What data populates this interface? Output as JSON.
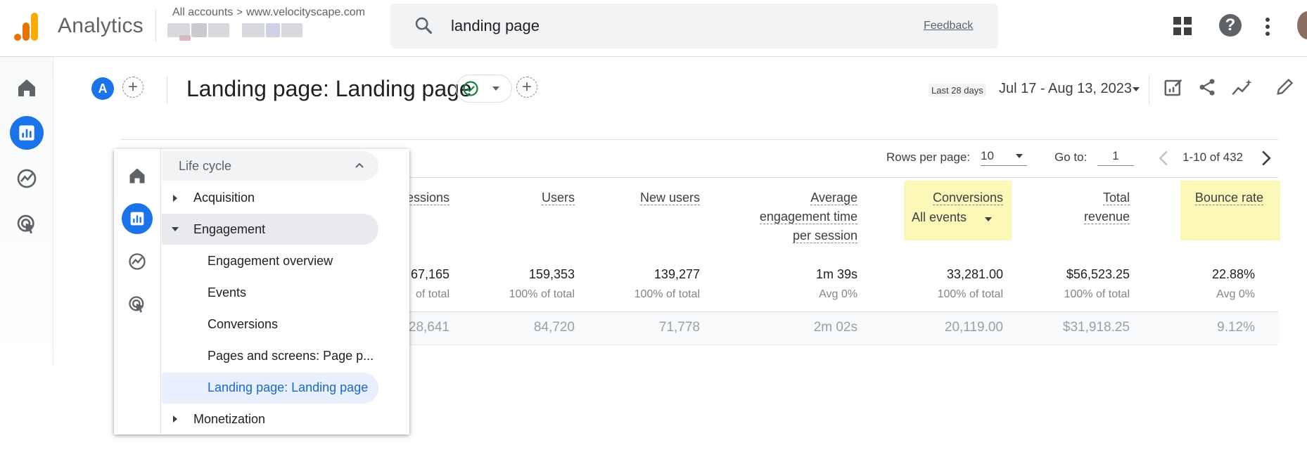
{
  "header": {
    "app_name": "Analytics",
    "breadcrumb_all": "All accounts",
    "breadcrumb_site": "www.velocityscape.com",
    "search_value": "landing page",
    "feedback_label": "Feedback"
  },
  "toolbar": {
    "segment_letter": "A",
    "page_title": "Landing page: Landing page",
    "date_label": "Last 28 days",
    "date_range": "Jul 17 - Aug 13, 2023"
  },
  "pagination": {
    "rows_label": "Rows per page:",
    "rows_value": "10",
    "goto_label": "Go to:",
    "goto_value": "1",
    "range": "1-10 of 432"
  },
  "table": {
    "columns": [
      {
        "label": "essions"
      },
      {
        "label": "Users"
      },
      {
        "label": "New users"
      },
      {
        "label_lines": [
          "Average",
          "engagement time",
          "per session"
        ]
      },
      {
        "label": "Conversions",
        "sub": "All events"
      },
      {
        "label_lines": [
          "Total",
          "revenue"
        ]
      },
      {
        "label": "Bounce rate"
      }
    ],
    "totals": [
      "67,165",
      "159,353",
      "139,277",
      "1m 39s",
      "33,281.00",
      "$56,523.25",
      "22.88%"
    ],
    "totals_sub": [
      "of total",
      "100% of total",
      "100% of total",
      "Avg 0%",
      "100% of total",
      "100% of total",
      "Avg 0%"
    ],
    "row1": [
      "28,641",
      "84,720",
      "71,778",
      "2m 02s",
      "20,119.00",
      "$31,918.25",
      "9.12%"
    ]
  },
  "nav": {
    "section": "Life cycle",
    "items": [
      {
        "label": "Acquisition"
      },
      {
        "label": "Engagement"
      },
      {
        "label": "Engagement overview"
      },
      {
        "label": "Events"
      },
      {
        "label": "Conversions"
      },
      {
        "label": "Pages and screens: Page p..."
      },
      {
        "label": "Landing page: Landing page"
      },
      {
        "label": "Monetization"
      }
    ]
  },
  "colors": {
    "accent": "#1a73e8",
    "highlight": "#fcf8b8",
    "logo_orange": "#f9ab00",
    "logo_dark_orange": "#e37400",
    "check_green": "#188038"
  },
  "icons": [
    "analytics-logo-icon",
    "search-icon",
    "apps-grid-icon",
    "help-icon",
    "more-vert-icon",
    "home-icon",
    "reports-icon",
    "explore-icon",
    "advertising-icon",
    "check-circle-icon",
    "dropdown-icon",
    "add-icon",
    "customize-report-icon",
    "share-icon",
    "insights-icon",
    "edit-icon",
    "chevron-left-icon",
    "chevron-right-icon",
    "chevron-up-icon"
  ]
}
